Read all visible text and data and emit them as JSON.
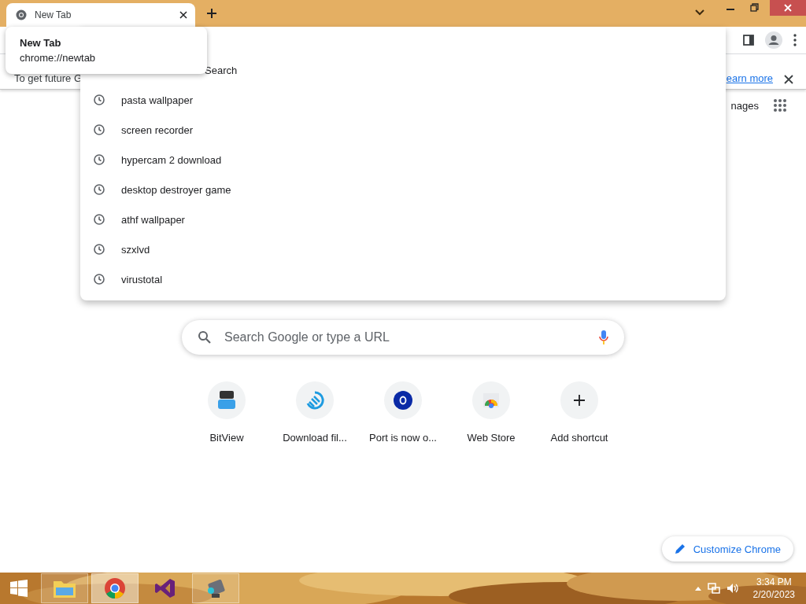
{
  "tab": {
    "title": "New Tab",
    "selected": true
  },
  "tab_tooltip": {
    "title": "New Tab",
    "url": "chrome://newtab"
  },
  "infobar": {
    "text": "To get future G",
    "link": "earn more"
  },
  "header_links": [
    "nages"
  ],
  "omnibox_suggestions": [
    {
      "text": "Search"
    },
    {
      "text": "pasta wallpaper"
    },
    {
      "text": "screen recorder"
    },
    {
      "text": "hypercam 2 download"
    },
    {
      "text": "desktop destroyer game"
    },
    {
      "text": "athf wallpaper"
    },
    {
      "text": "szxlvd"
    },
    {
      "text": "virustotal"
    }
  ],
  "search": {
    "placeholder": "Search Google or type a URL"
  },
  "shortcuts": [
    {
      "label": "BitView",
      "kind": "bitview"
    },
    {
      "label": "Download fil...",
      "kind": "swirl"
    },
    {
      "label": "Port is now o...",
      "kind": "port"
    },
    {
      "label": "Web Store",
      "kind": "webstore"
    },
    {
      "label": "Add shortcut",
      "kind": "add"
    }
  ],
  "customize_button": "Customize Chrome",
  "taskbar": {
    "apps": [
      {
        "kind": "explorer",
        "running": true,
        "active": false
      },
      {
        "kind": "chrome",
        "running": true,
        "active": true
      },
      {
        "kind": "vs",
        "running": false,
        "active": false
      },
      {
        "kind": "camera",
        "running": true,
        "active": false
      }
    ],
    "time": "3:34 PM",
    "date": "2/20/2023"
  }
}
